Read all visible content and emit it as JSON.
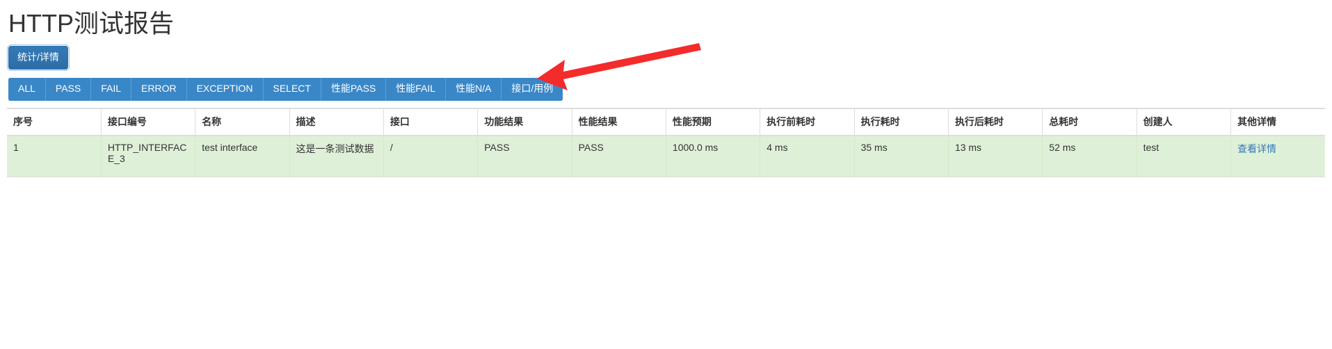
{
  "header": {
    "title": "HTTP测试报告"
  },
  "toolbar": {
    "toggle_label": "统计/详情"
  },
  "filters": {
    "items": [
      {
        "label": "ALL",
        "name": "filter-all"
      },
      {
        "label": "PASS",
        "name": "filter-pass"
      },
      {
        "label": "FAIL",
        "name": "filter-fail"
      },
      {
        "label": "ERROR",
        "name": "filter-error"
      },
      {
        "label": "EXCEPTION",
        "name": "filter-exception"
      },
      {
        "label": "SELECT",
        "name": "filter-select"
      },
      {
        "label": "性能PASS",
        "name": "filter-perf-pass"
      },
      {
        "label": "性能FAIL",
        "name": "filter-perf-fail"
      },
      {
        "label": "性能N/A",
        "name": "filter-perf-na"
      },
      {
        "label": "接口/用例",
        "name": "filter-interface-case"
      }
    ]
  },
  "table": {
    "columns": [
      "序号",
      "接口编号",
      "名称",
      "描述",
      "接口",
      "功能结果",
      "性能结果",
      "性能预期",
      "执行前耗时",
      "执行耗时",
      "执行后耗时",
      "总耗时",
      "创建人",
      "其他详情"
    ],
    "rows": [
      {
        "index": "1",
        "interface_code": "HTTP_INTERFACE_3",
        "name": "test interface",
        "description": "这是一条测试数据",
        "interface": "/",
        "function_result": "PASS",
        "performance_result": "PASS",
        "performance_expect": "1000.0 ms",
        "time_before": "4 ms",
        "time_run": "35 ms",
        "time_after": "13 ms",
        "time_total": "52 ms",
        "creator": "test",
        "detail_link": "查看详情"
      }
    ]
  },
  "annotation": {
    "arrow_color": "#f42b2b"
  },
  "colors": {
    "primary_button": "#2e6da4",
    "filter_bar": "#3a87c8",
    "row_success_bg": "#dff0d8",
    "link": "#337ab7",
    "arrow_red": "#f42b2b"
  }
}
